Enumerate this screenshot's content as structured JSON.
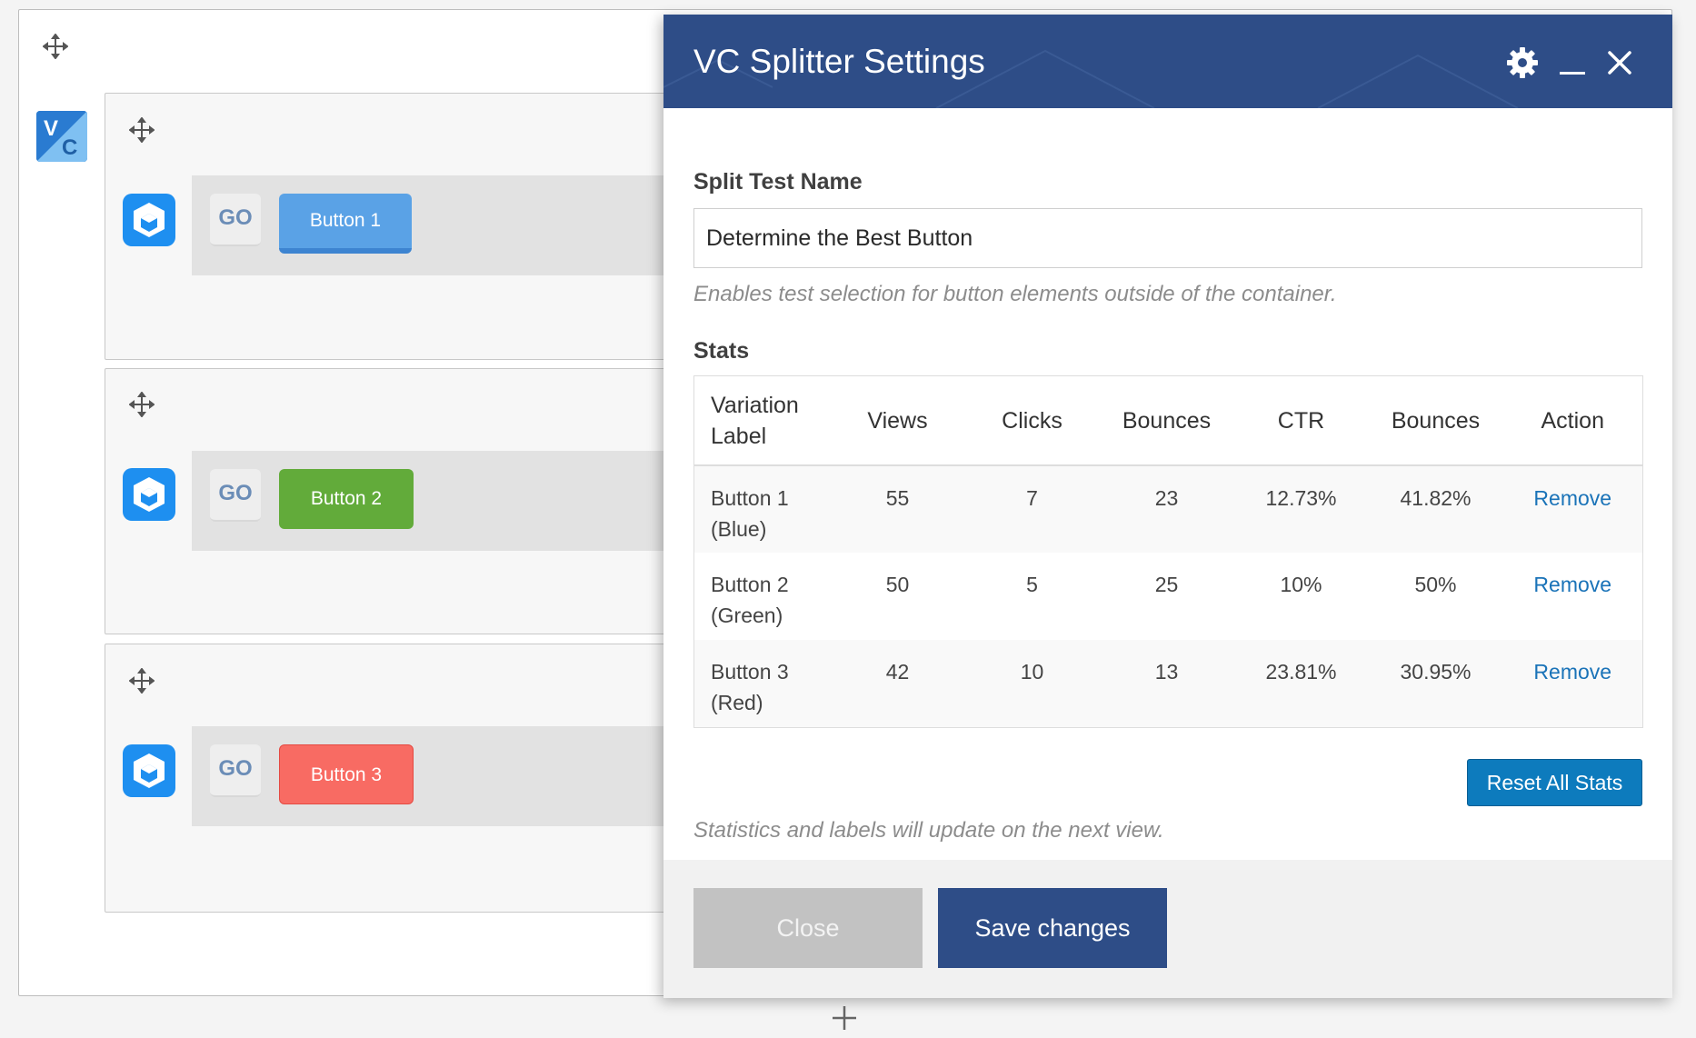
{
  "builder": {
    "rows": [
      {
        "go_label": "GO",
        "button_label": "Button 1",
        "button_color": "#5aa2e6"
      },
      {
        "go_label": "GO",
        "button_label": "Button 2",
        "button_color": "#62ab3a"
      },
      {
        "go_label": "GO",
        "button_label": "Button 3",
        "button_color": "#f86b63"
      }
    ]
  },
  "modal": {
    "title": "VC Splitter Settings",
    "header_color": "#2e4d87",
    "split_test_label": "Split Test Name",
    "split_test_value": "Determine the Best Button",
    "split_test_help": "Enables test selection for button elements outside of the container.",
    "stats_label": "Stats",
    "columns": [
      "Variation Label",
      "Views",
      "Clicks",
      "Bounces",
      "CTR",
      "Bounces",
      "Action"
    ],
    "rows": [
      {
        "label": "Button 1 (Blue)",
        "views": "55",
        "clicks": "7",
        "bounces": "23",
        "ctr": "12.73%",
        "bounce_rate": "41.82%",
        "action": "Remove"
      },
      {
        "label": "Button 2 (Green)",
        "views": "50",
        "clicks": "5",
        "bounces": "25",
        "ctr": "10%",
        "bounce_rate": "50%",
        "action": "Remove"
      },
      {
        "label": "Button 3 (Red)",
        "views": "42",
        "clicks": "10",
        "bounces": "13",
        "ctr": "23.81%",
        "bounce_rate": "30.95%",
        "action": "Remove"
      }
    ],
    "reset_label": "Reset All Stats",
    "footer_note": "Statistics and labels will update on the next view.",
    "close_label": "Close",
    "save_label": "Save changes"
  }
}
